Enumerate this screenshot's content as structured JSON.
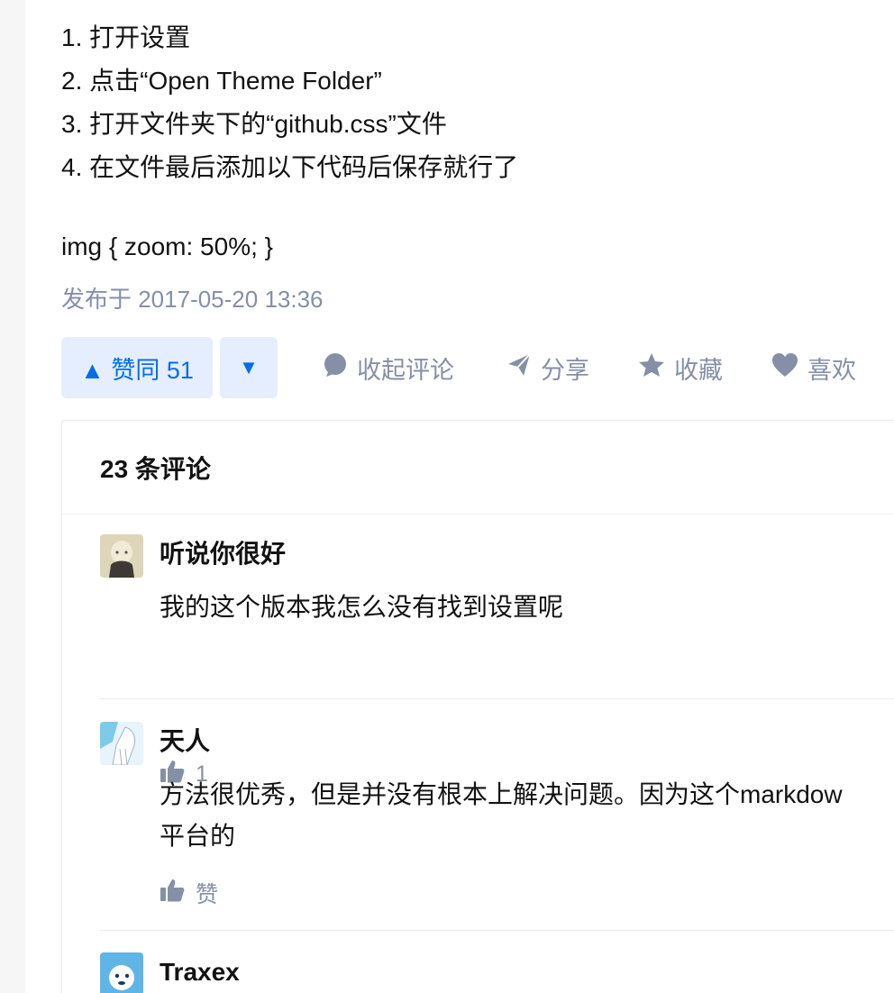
{
  "article": {
    "steps": [
      "1. 打开设置",
      "2. 点击“Open Theme Folder”",
      "3. 打开文件夹下的“github.css”文件",
      "4. 在文件最后添加以下代码后保存就行了"
    ],
    "code": "img { zoom: 50%; }",
    "published": "发布于 2017-05-20 13:36"
  },
  "actions": {
    "vote_up_label": "▲ 赞同 51",
    "vote_down_label": "▼",
    "collapse_comments": "收起评论",
    "share": "分享",
    "collect": "收藏",
    "like": "喜欢"
  },
  "comments": {
    "header": "23 条评论",
    "items": [
      {
        "author": "听说你很好",
        "text": "我的这个版本我怎么没有找到设置呢",
        "likes": "1"
      },
      {
        "author": "天人",
        "text_line1": "方法很优秀，但是并没有根本上解决问题。因为这个markdow",
        "text_line2": "平台的",
        "likes": "赞"
      },
      {
        "author": "Traxex"
      }
    ]
  },
  "colors": {
    "accent": "#056de8",
    "accent_bg": "#e5eeff",
    "muted": "#8590a6",
    "text": "#121212"
  }
}
